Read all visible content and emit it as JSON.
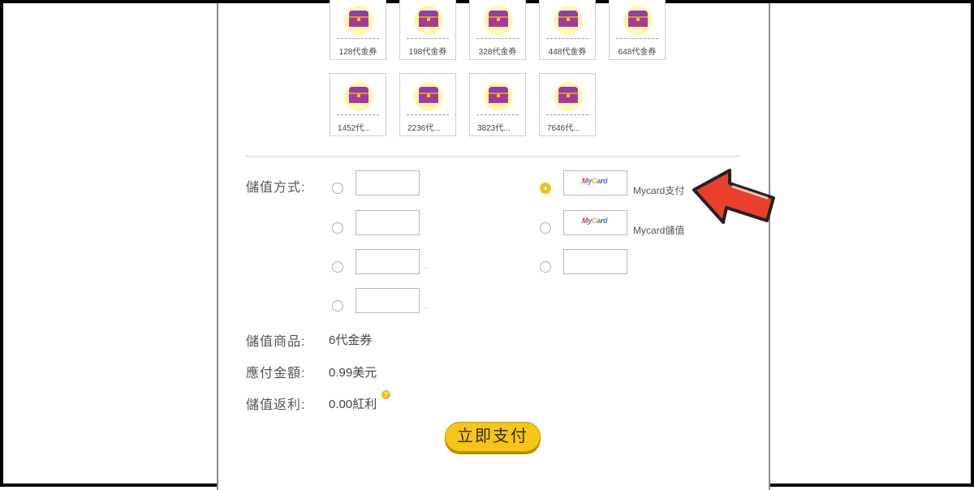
{
  "items": [
    {
      "label": "128代金券"
    },
    {
      "label": "198代金券"
    },
    {
      "label": "328代金券"
    },
    {
      "label": "448代金券"
    },
    {
      "label": "648代金券"
    },
    {
      "label": "1452代..."
    },
    {
      "label": "2236代..."
    },
    {
      "label": "3823代..."
    },
    {
      "label": "7646代..."
    }
  ],
  "payment": {
    "label": "儲值方式:",
    "options": [
      {
        "text": "Mycard支付",
        "logo": "MyCard"
      },
      {
        "text": "Mycard儲值",
        "logo": "MyCard"
      }
    ]
  },
  "summary": {
    "product_label": "儲值商品:",
    "product_value": "6代金券",
    "amount_label": "應付金額:",
    "amount_value": "0.99美元",
    "rebate_label": "儲值返利:",
    "rebate_value": "0.00紅利",
    "help_mark": "?"
  },
  "pay_button": "立即支付",
  "colors": {
    "accent": "#f5c518",
    "arrow": "#e8402a"
  }
}
